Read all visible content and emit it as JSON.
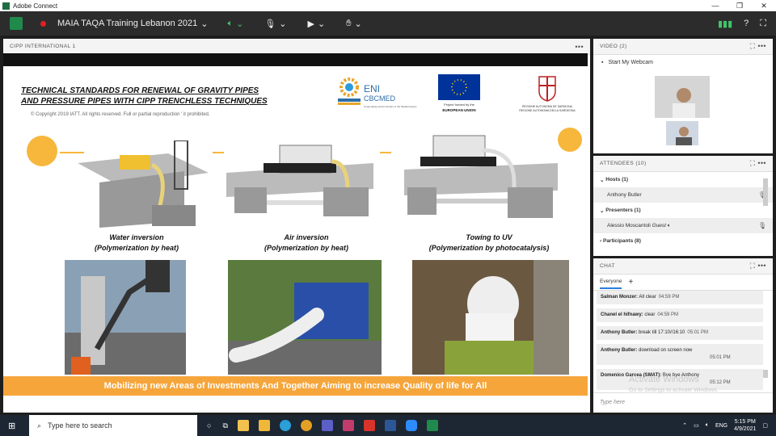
{
  "window": {
    "title": "Adobe Connect",
    "controls": [
      "—",
      "❐",
      "✕"
    ]
  },
  "toolbar": {
    "meeting_name": "MAIA TAQA Training Lebanon 2021",
    "speaker_icon": "speaker-icon",
    "mic_icon": "mic-icon",
    "camera_icon": "camera-icon",
    "raise_hand_icon": "raise-hand-icon",
    "accent": "#41c36b",
    "record_color": "#e02020"
  },
  "share_pod": {
    "title": "CIPP INTERNATIONAL 1",
    "slide": {
      "title": "TECHNICAL STANDARDS FOR RENEWAL OF GRAVITY PIPES AND PRESSURE PIPES WITH CIPP TRENCHLESS TECHNIQUES",
      "copyright": "© Copyright 2019  IATT. All rights reserved. Full or partial reproduction ' it prohibited.",
      "logos": {
        "eni": "ENI",
        "cbcmed": "CBCMED",
        "eni_sub": "Cooperating across borders in the Mediterranean",
        "eu_caption_1": "Project funded by the",
        "eu_caption_2": "EUROPEAN UNION",
        "sard_1": "REGIONE AUTONOMA DE SARDIGNA",
        "sard_2": "REGIONE AUTONOMA DELLA SARDEGNA"
      },
      "methods": [
        {
          "name": "Water inversion",
          "sub": "(Polymerization by heat)"
        },
        {
          "name": "Air inversion",
          "sub": "(Polymerization by heat)"
        },
        {
          "name": "Towing to UV",
          "sub": "(Polymerization by photocatalysis)"
        }
      ],
      "banner": "Mobilizing new Areas of Investments And Together Aiming to increase Quality of life for All",
      "accent": "#f6a53a"
    }
  },
  "video_pod": {
    "title": "VIDEO (2)",
    "start_webcam": "Start My Webcam"
  },
  "attendees_pod": {
    "title": "ATTENDEES",
    "count": "(10)",
    "hosts": "Hosts (1)",
    "host_name": "Anthony Butler",
    "presenters": "Presenters (1)",
    "presenter_name": "Alessio Moscantoli",
    "presenter_role": "Guest",
    "participants": "Participants (8)"
  },
  "chat_pod": {
    "title": "CHAT",
    "tab": "Everyone",
    "messages": [
      {
        "name": "Salman Monzer:",
        "text": "All clear",
        "time": "04:59 PM"
      },
      {
        "name": "Chanel el hifnawy:",
        "text": "clear",
        "time": "04:59 PM"
      },
      {
        "name": "Anthony Butler:",
        "text": "break till 17:10//16:10",
        "time": "05:01 PM"
      },
      {
        "name": "Anthony Butler:",
        "text": "download on screen now",
        "time": "05:01 PM"
      },
      {
        "name": "Domenico Garcea (SMAT):",
        "text": "Bye bye Anthony",
        "time": "05:12 PM"
      }
    ],
    "input_placeholder": "Type here",
    "watermark_1": "Activate Windows",
    "watermark_2": "Go to Settings to activate Windows."
  },
  "taskbar": {
    "search_placeholder": "Type here to search",
    "lang": "ENG",
    "time": "5:15 PM",
    "date": "4/9/2021"
  }
}
